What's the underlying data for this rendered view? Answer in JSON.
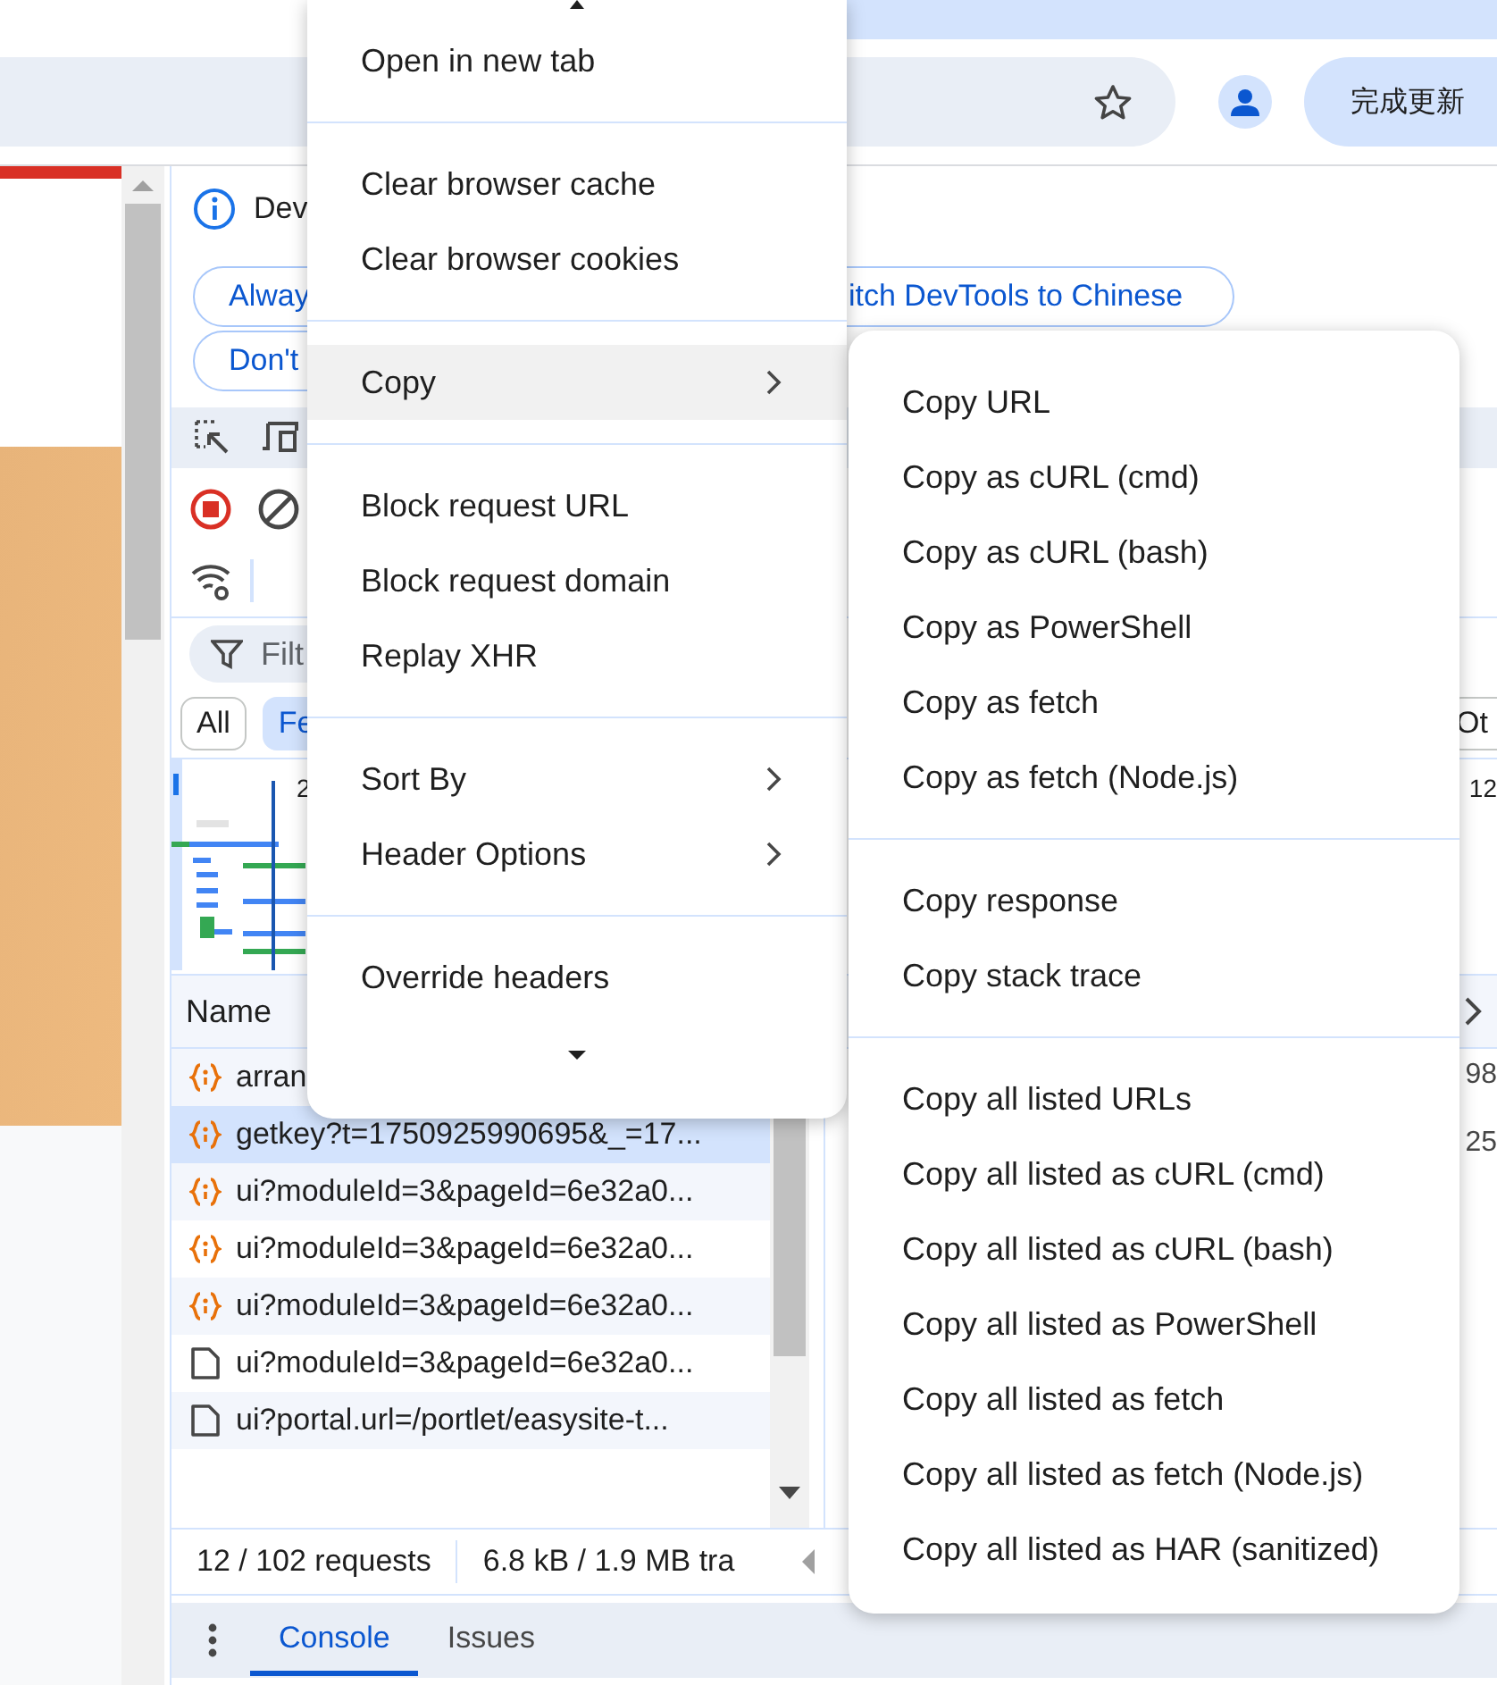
{
  "browser": {
    "update_button": "完成更新"
  },
  "devtools": {
    "info_text": "Dev",
    "language_buttons": [
      {
        "label": "Alway"
      },
      {
        "label": "itch DevTools to Chinese"
      },
      {
        "label": "Don't"
      }
    ],
    "filter_placeholder": "Filt",
    "type_filters": [
      {
        "label": "All",
        "selected": false
      },
      {
        "label": "Fe",
        "selected": true
      },
      {
        "label": "Ot",
        "selected": false
      }
    ],
    "overview_ticks": [
      "2",
      "12"
    ],
    "name_header": "Name",
    "requests": [
      {
        "name": "arran",
        "kind": "script",
        "selected": false,
        "column_2": "98"
      },
      {
        "name": "getkey?t=1750925990695&_=17...",
        "kind": "script",
        "selected": true,
        "column_2": "25"
      },
      {
        "name": "ui?moduleId=3&pageId=6e32a0...",
        "kind": "script",
        "selected": false
      },
      {
        "name": "ui?moduleId=3&pageId=6e32a0...",
        "kind": "script",
        "selected": false
      },
      {
        "name": "ui?moduleId=3&pageId=6e32a0...",
        "kind": "script",
        "selected": false
      },
      {
        "name": "ui?moduleId=3&pageId=6e32a0...",
        "kind": "document",
        "selected": false
      },
      {
        "name": "ui?portal.url=/portlet/easysite-t...",
        "kind": "document",
        "selected": false
      }
    ],
    "status": [
      "12 / 102 requests",
      "6.8 kB / 1.9 MB tra"
    ],
    "drawer_tabs": [
      {
        "label": "Console",
        "selected": true
      },
      {
        "label": "Issues",
        "selected": false
      }
    ]
  },
  "context_menu": {
    "groups": [
      [
        {
          "label": "Open in new tab",
          "submenu": false,
          "selected": false
        }
      ],
      [
        {
          "label": "Clear browser cache",
          "submenu": false,
          "selected": false
        },
        {
          "label": "Clear browser cookies",
          "submenu": false,
          "selected": false
        }
      ],
      [
        {
          "label": "Copy",
          "submenu": true,
          "selected": true
        }
      ],
      [
        {
          "label": "Block request URL",
          "submenu": false,
          "selected": false
        },
        {
          "label": "Block request domain",
          "submenu": false,
          "selected": false
        },
        {
          "label": "Replay XHR",
          "submenu": false,
          "selected": false
        }
      ],
      [
        {
          "label": "Sort By",
          "submenu": true,
          "selected": false
        },
        {
          "label": "Header Options",
          "submenu": true,
          "selected": false
        }
      ],
      [
        {
          "label": "Override headers",
          "submenu": false,
          "selected": false
        }
      ]
    ]
  },
  "copy_submenu": {
    "groups": [
      [
        {
          "label": "Copy URL",
          "submenu": false,
          "selected": false
        },
        {
          "label": "Copy as cURL (cmd)",
          "submenu": false,
          "selected": false
        },
        {
          "label": "Copy as cURL (bash)",
          "submenu": false,
          "selected": false
        },
        {
          "label": "Copy as PowerShell",
          "submenu": false,
          "selected": false
        },
        {
          "label": "Copy as fetch",
          "submenu": false,
          "selected": false
        },
        {
          "label": "Copy as fetch (Node.js)",
          "submenu": false,
          "selected": false
        }
      ],
      [
        {
          "label": "Copy response",
          "submenu": false,
          "selected": false
        },
        {
          "label": "Copy stack trace",
          "submenu": false,
          "selected": false
        }
      ],
      [
        {
          "label": "Copy all listed URLs",
          "submenu": false,
          "selected": false
        },
        {
          "label": "Copy all listed as cURL (cmd)",
          "submenu": false,
          "selected": false
        },
        {
          "label": "Copy all listed as cURL (bash)",
          "submenu": false,
          "selected": false
        },
        {
          "label": "Copy all listed as PowerShell",
          "submenu": false,
          "selected": false
        },
        {
          "label": "Copy all listed as fetch",
          "submenu": false,
          "selected": false
        },
        {
          "label": "Copy all listed as fetch (Node.js)",
          "submenu": false,
          "selected": false
        },
        {
          "label": "Copy all listed as HAR (sanitized)",
          "submenu": false,
          "selected": false
        }
      ]
    ]
  }
}
